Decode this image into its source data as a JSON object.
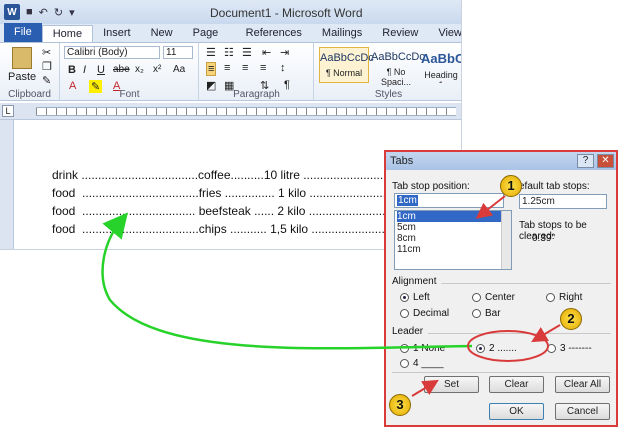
{
  "app": {
    "title": "Document1 - Microsoft Word",
    "logo": "W"
  },
  "tabs": [
    "File",
    "Home",
    "Insert",
    "New Tab",
    "Page Layout",
    "References",
    "Mailings",
    "Review",
    "View"
  ],
  "ribbon": {
    "clipboard": {
      "label": "Clipboard",
      "paste": "Paste"
    },
    "font": {
      "label": "Font",
      "name": "Calibri (Body)",
      "size": "11",
      "bold": "B",
      "italic": "I",
      "underline": "U",
      "abc": "abe",
      "x2": "x₂",
      "x2u": "x²",
      "aa": "Aa",
      "color_a": "A"
    },
    "paragraph": {
      "label": "Paragraph",
      "pilcrow": "¶"
    },
    "styles": {
      "label": "Styles",
      "items": [
        {
          "preview": "AaBbCcDc",
          "name": "¶ Normal"
        },
        {
          "preview": "AaBbCcDc",
          "name": "¶ No Spaci..."
        },
        {
          "preview": "AaBbC",
          "name": "Heading 1"
        }
      ]
    }
  },
  "document": {
    "lines": [
      "drink ...................................coffee..........10 litre ..........................10,00",
      "food  ...................................fries ............... 1 kilo ..........................10,00",
      "food  .................................. beefsteak ...... 2 kilo ........................120,00",
      "food  ...................................chips ........... 1,5 kilo ...........................95,00"
    ]
  },
  "dialog": {
    "title": "Tabs",
    "help": "?",
    "close": "✕",
    "tab_stop_label": "Tab stop position:",
    "tab_stop_value": "1cm",
    "tab_stops": [
      "1cm",
      "5cm",
      "8cm",
      "11cm"
    ],
    "default_label": "efault tab stops:",
    "default_value": "1.25cm",
    "cleared_label": "Tab stops to be cleared:",
    "cleared_value": "0.39\"",
    "alignment_label": "Alignment",
    "alignment": {
      "left": "Left",
      "center": "Center",
      "right": "Right",
      "decimal": "Decimal",
      "bar": "Bar"
    },
    "leader_label": "Leader",
    "leader": {
      "none": "1 None",
      "dots": "2 .......",
      "dashes": "3 -------",
      "line": "4 ____"
    },
    "buttons": {
      "set": "Set",
      "clear": "Clear",
      "clear_all": "Clear All",
      "ok": "OK",
      "cancel": "Cancel"
    }
  },
  "callouts": [
    "1",
    "2",
    "3"
  ],
  "colors": {
    "accent_red": "#d93b3b",
    "arrow_green": "#27d22a",
    "badge": "#ffd400"
  }
}
